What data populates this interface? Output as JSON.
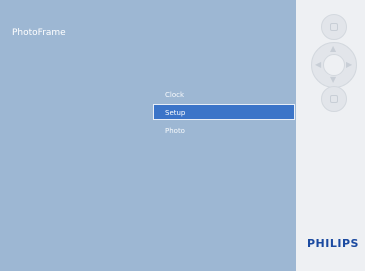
{
  "screen": {
    "title": "PhotoFrame",
    "menu": {
      "items": [
        {
          "label": "Clock",
          "selected": false
        },
        {
          "label": "Setup",
          "selected": true
        },
        {
          "label": "Photo",
          "selected": false
        }
      ]
    }
  },
  "side_panel": {
    "icons": {
      "top_button": "slideshow-icon",
      "dpad": "dpad-navigation-icon",
      "bottom_button": "menu-icon"
    },
    "logo": "PHILIPS"
  },
  "colors": {
    "screen_bg": "#9db7d3",
    "selection": "#3b74c8",
    "panel_bg": "#eef0f3",
    "brand_blue": "#1b4aa0"
  }
}
